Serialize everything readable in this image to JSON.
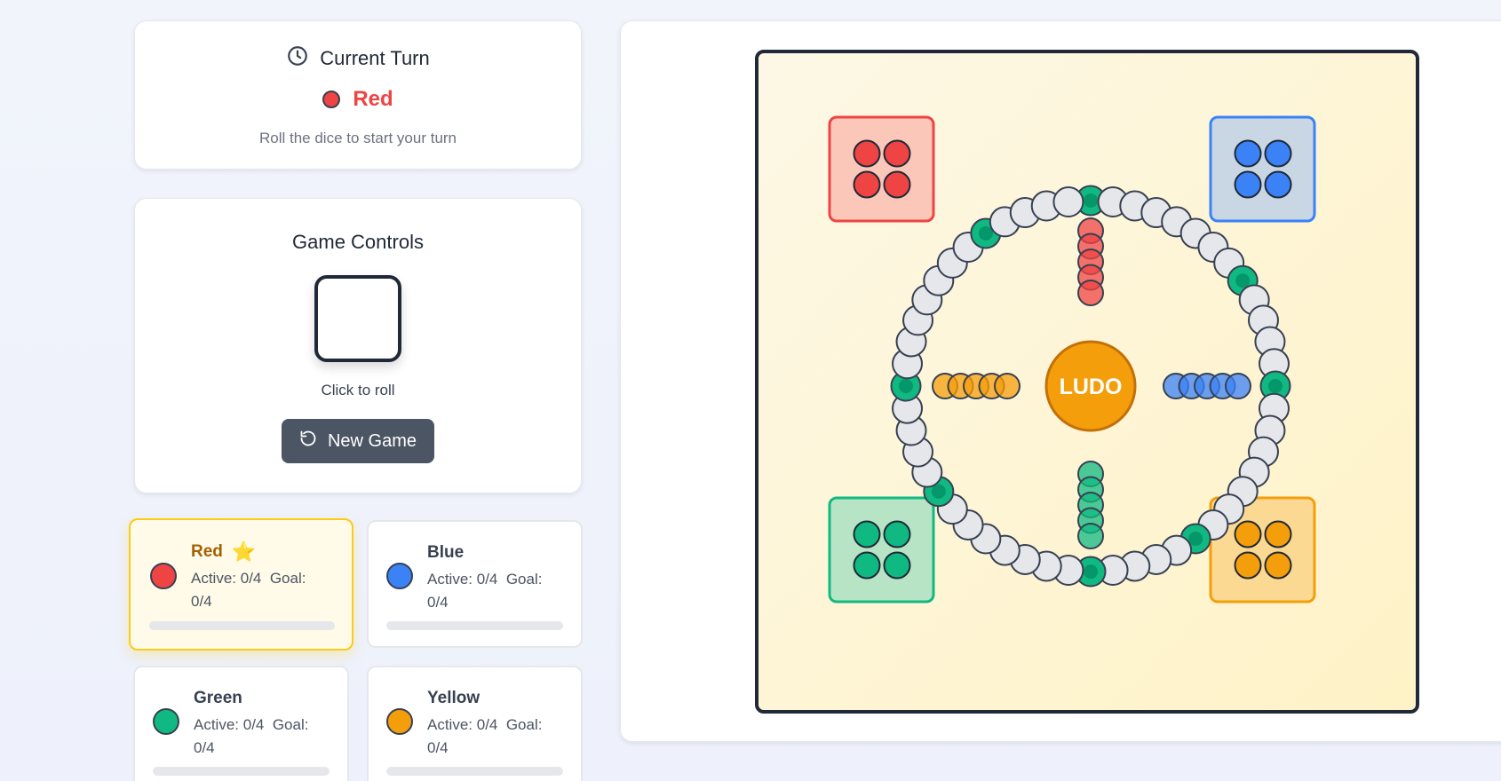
{
  "current_turn": {
    "heading": "Current Turn",
    "player": "Red",
    "player_color": "#ef4444",
    "hint": "Roll the dice to start your turn",
    "icon": "clock-icon"
  },
  "controls": {
    "title": "Game Controls",
    "dice_value": null,
    "roll_hint": "Click to roll",
    "new_game_label": "New Game",
    "new_game_icon": "restart-icon"
  },
  "players": [
    {
      "name": "Red",
      "color": "#ef4444",
      "active": true,
      "badge": "⭐",
      "active_label": "Active: 0/4",
      "goal_label": "Goal:",
      "goal_value": "0/4",
      "progress": 0
    },
    {
      "name": "Blue",
      "color": "#3b82f6",
      "active": false,
      "badge": "",
      "active_label": "Active: 0/4",
      "goal_label": "Goal:",
      "goal_value": "0/4",
      "progress": 0
    },
    {
      "name": "Green",
      "color": "#10b981",
      "active": false,
      "badge": "",
      "active_label": "Active: 0/4",
      "goal_label": "Goal:",
      "goal_value": "0/4",
      "progress": 0
    },
    {
      "name": "Yellow",
      "color": "#f59e0b",
      "active": false,
      "badge": "",
      "active_label": "Active: 0/4",
      "goal_label": "Goal:",
      "goal_value": "0/4",
      "progress": 0
    }
  ],
  "board": {
    "center_label": "LUDO",
    "colors": {
      "red": "#ef4444",
      "blue": "#3b82f6",
      "green": "#10b981",
      "yellow": "#f59e0b",
      "track": "#e5e7eb",
      "board_bg": "#fef9e7",
      "center": "#f59e0b"
    },
    "home_pieces_per_player": 4,
    "track_cells": 52,
    "safe_cells": [
      0,
      8,
      13,
      21,
      26,
      34,
      39,
      47
    ],
    "home_column_cells": 5
  }
}
